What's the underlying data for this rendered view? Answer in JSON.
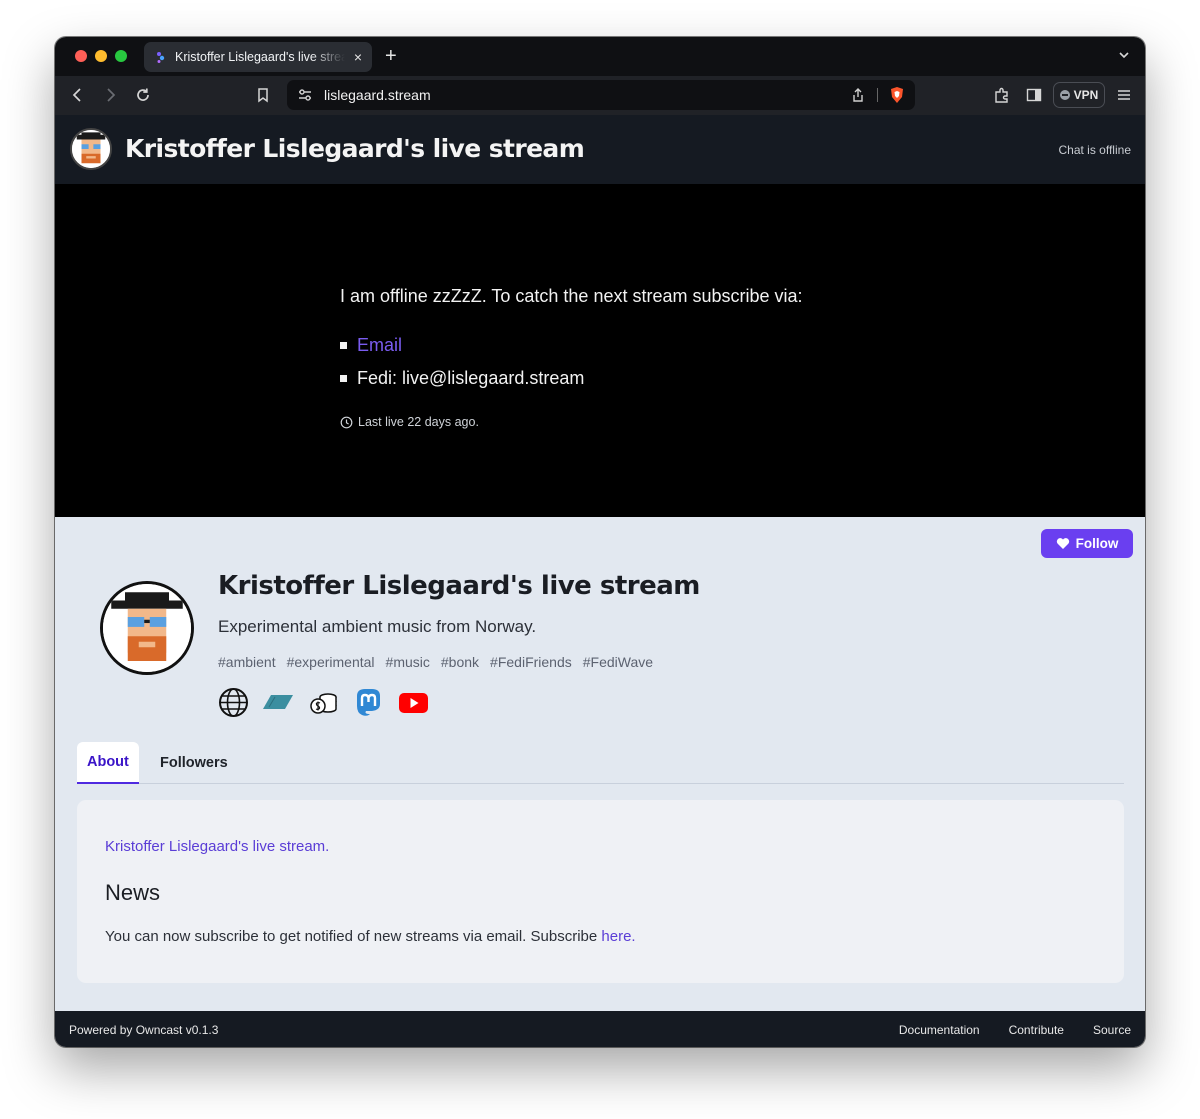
{
  "browser": {
    "tab_title": "Kristoffer Lislegaard's live stream",
    "tab_close": "×",
    "new_tab": "+",
    "url": "lislegaard.stream",
    "vpn_label": "VPN"
  },
  "header": {
    "title": "Kristoffer Lislegaard's live stream",
    "chat_status": "Chat is offline"
  },
  "offline": {
    "message": "I am offline zzZzZ. To catch the next stream subscribe via:",
    "items": [
      {
        "label": "Email"
      },
      {
        "label": "Fedi: live@lislegaard.stream"
      }
    ],
    "last_live": "Last live 22 days ago."
  },
  "profile": {
    "follow_label": "Follow",
    "name": "Kristoffer Lislegaard's live stream",
    "description": "Experimental ambient music from Norway.",
    "tags": [
      "#ambient",
      "#experimental",
      "#music",
      "#bonk",
      "#FediFriends",
      "#FediWave"
    ],
    "social_icons": [
      "globe-icon",
      "liberapay-icon",
      "coins-icon",
      "mastodon-icon",
      "youtube-icon"
    ]
  },
  "tabs": {
    "about": "About",
    "followers": "Followers"
  },
  "about": {
    "intro": "Kristoffer Lislegaard's live stream.",
    "news_heading": "News",
    "news_text": "You can now subscribe to get notified of new streams via email. Subscribe ",
    "news_link": "here."
  },
  "footer": {
    "powered_by": "Powered by Owncast v0.1.3",
    "links": [
      "Documentation",
      "Contribute",
      "Source"
    ]
  },
  "colors": {
    "accent": "#6a3ff0",
    "header_bg": "#151a22",
    "offline_bg": "#000000",
    "page_bg": "#e2e8f0"
  }
}
